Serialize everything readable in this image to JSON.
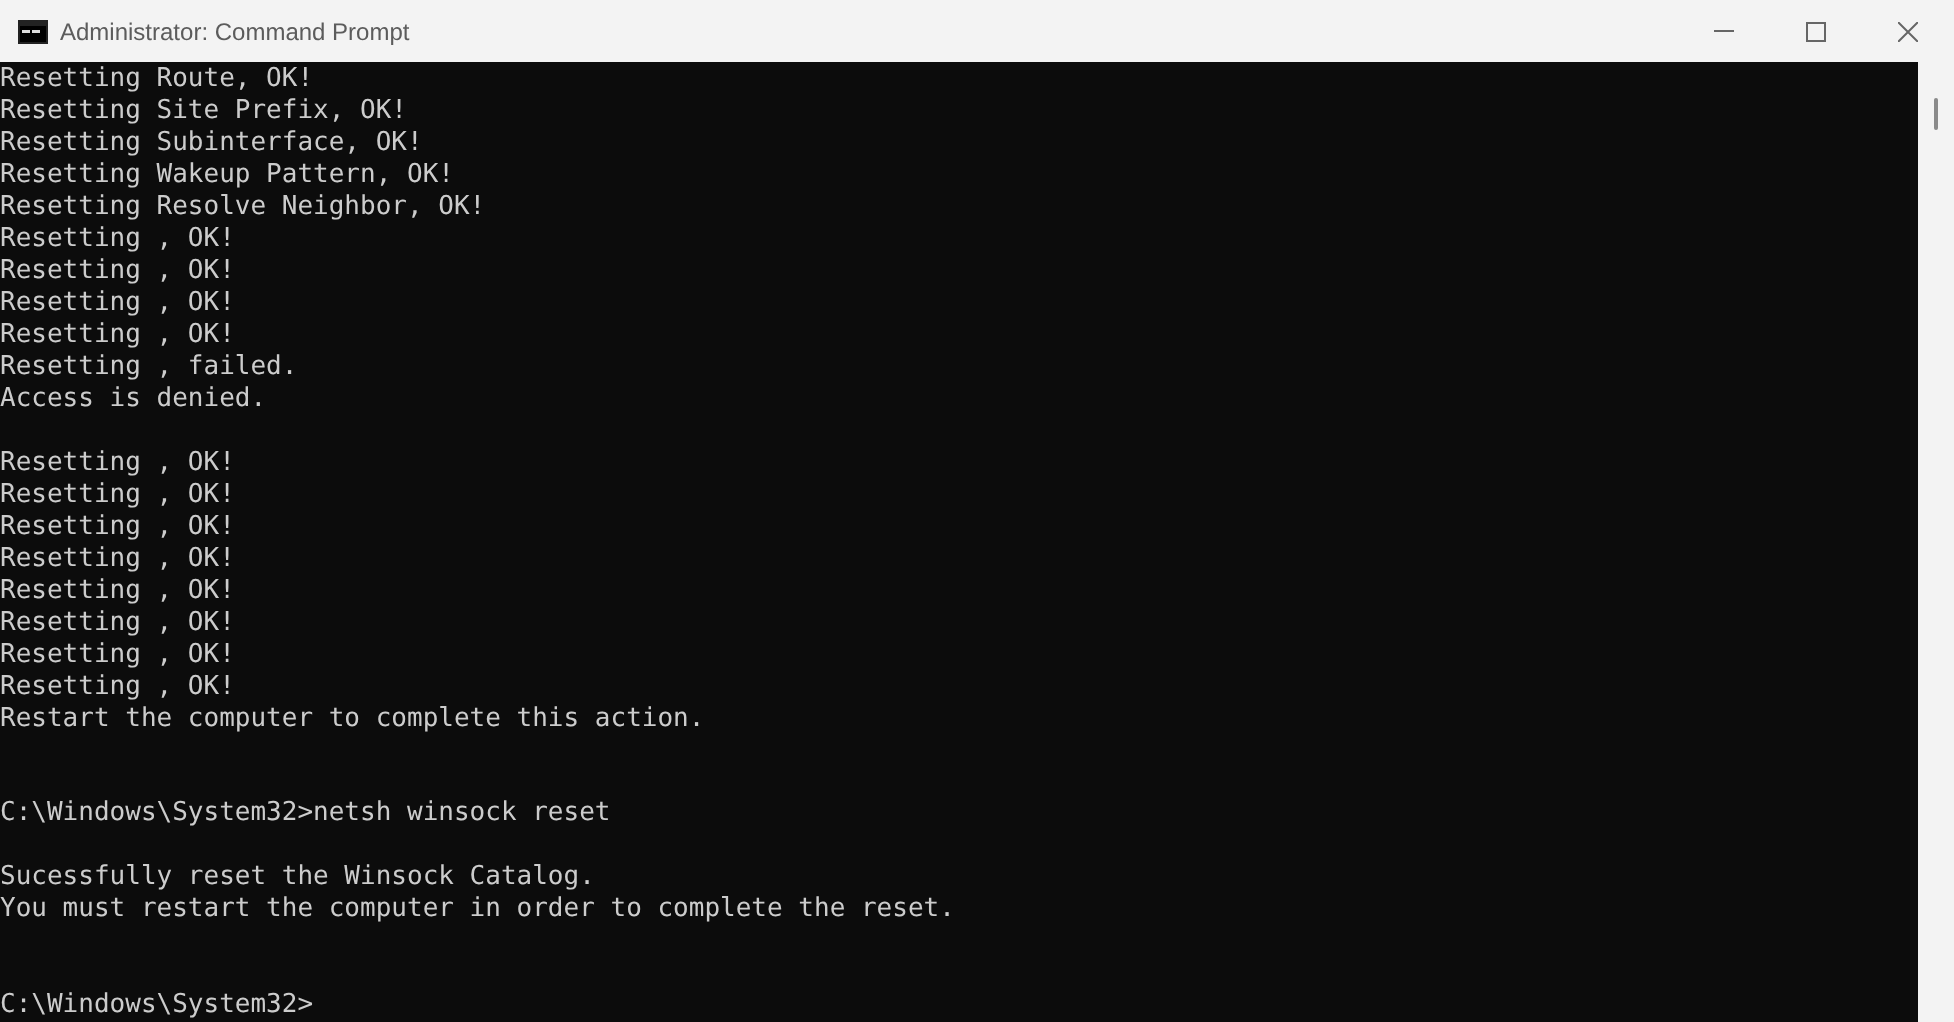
{
  "window": {
    "title": "Administrator: Command Prompt"
  },
  "console": {
    "lines": [
      {
        "kind": "text",
        "text": "Resetting Route, OK!"
      },
      {
        "kind": "text",
        "text": "Resetting Site Prefix, OK!"
      },
      {
        "kind": "text",
        "text": "Resetting Subinterface, OK!"
      },
      {
        "kind": "text",
        "text": "Resetting Wakeup Pattern, OK!"
      },
      {
        "kind": "text",
        "text": "Resetting Resolve Neighbor, OK!"
      },
      {
        "kind": "text",
        "text": "Resetting , OK!"
      },
      {
        "kind": "text",
        "text": "Resetting , OK!"
      },
      {
        "kind": "text",
        "text": "Resetting , OK!"
      },
      {
        "kind": "text",
        "text": "Resetting , OK!"
      },
      {
        "kind": "text",
        "text": "Resetting , failed."
      },
      {
        "kind": "text",
        "text": "Access is denied."
      },
      {
        "kind": "blank"
      },
      {
        "kind": "text",
        "text": "Resetting , OK!"
      },
      {
        "kind": "text",
        "text": "Resetting , OK!"
      },
      {
        "kind": "text",
        "text": "Resetting , OK!"
      },
      {
        "kind": "text",
        "text": "Resetting , OK!"
      },
      {
        "kind": "text",
        "text": "Resetting , OK!"
      },
      {
        "kind": "text",
        "text": "Resetting , OK!"
      },
      {
        "kind": "text",
        "text": "Resetting , OK!"
      },
      {
        "kind": "text",
        "text": "Resetting , OK!"
      },
      {
        "kind": "text",
        "text": "Restart the computer to complete this action."
      },
      {
        "kind": "blank"
      },
      {
        "kind": "blank"
      },
      {
        "kind": "text",
        "text": "C:\\Windows\\System32>netsh winsock reset"
      },
      {
        "kind": "blank"
      },
      {
        "kind": "text",
        "text": "Sucessfully reset the Winsock Catalog."
      },
      {
        "kind": "text",
        "text": "You must restart the computer in order to complete the reset."
      },
      {
        "kind": "blank"
      },
      {
        "kind": "blank"
      },
      {
        "kind": "text",
        "text": "C:\\Windows\\System32>"
      }
    ]
  }
}
